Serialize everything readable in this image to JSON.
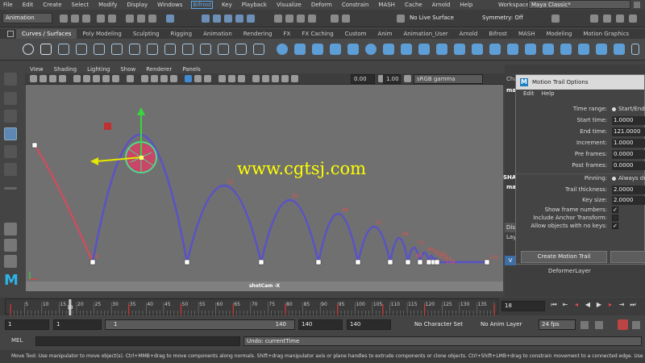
{
  "menubar": {
    "items": [
      "File",
      "Edit",
      "Create",
      "Select",
      "Modify",
      "Display",
      "Windows",
      "Bifrost",
      "Key",
      "Playback",
      "Visualize",
      "Deform",
      "Constrain",
      "MASH",
      "Cache",
      "Arnold",
      "Help"
    ],
    "highlighted": "Bifrost",
    "workspace_label": "Workspace :",
    "workspace_value": "Maya Classic*"
  },
  "status": {
    "mode": "Animation",
    "live_surface": "No Live Surface",
    "symmetry": "Symmetry: Off"
  },
  "shelf": {
    "tabs": [
      "Curves / Surfaces",
      "Poly Modeling",
      "Sculpting",
      "Rigging",
      "Animation",
      "Rendering",
      "FX",
      "FX Caching",
      "Custom",
      "Anim",
      "Animation_User",
      "Arnold",
      "Bifrost",
      "MASH",
      "Modeling",
      "Motion Graphics"
    ],
    "active_tab": "Curves / Surfaces"
  },
  "panel": {
    "menus": [
      "View",
      "Shading",
      "Lighting",
      "Show",
      "Renderer",
      "Panels"
    ],
    "exposure": "0.00",
    "gamma": "1.00",
    "color_space": "sRGB gamma",
    "camera": "shotCam -X"
  },
  "watermark": "www.cgtsj.com",
  "chart_data": {
    "type": "line",
    "title": "",
    "series": [
      {
        "name": "",
        "color": "#cc4e5e",
        "x": [
          1,
          18
        ],
        "y": [
          0,
          0
        ]
      },
      {
        "name": "",
        "color": "#5a52c6",
        "x": [
          18,
          35,
          50,
          65,
          80,
          95,
          108,
          120,
          140
        ],
        "y": [
          0,
          0,
          0,
          0,
          0,
          0,
          0,
          0,
          0
        ]
      }
    ],
    "frame_labels": [
      "8",
      "18",
      "22",
      "36",
      "48",
      "57",
      "66",
      "73",
      "83",
      "88",
      "92",
      "106",
      "112",
      "116",
      "118",
      "121"
    ]
  },
  "right_panel": {
    "channel_box_label": "Char",
    "shape_label": "SHAPE",
    "node_label": "main",
    "display_tab": "Disp",
    "layer_tab": "Laye",
    "deformer_layer": "DeformerLayer",
    "layer_v": "V"
  },
  "motion_trail": {
    "title": "Motion Trail Options",
    "menus": [
      "Edit",
      "Help"
    ],
    "time_range_label": "Time range:",
    "time_range_value": "Start/End",
    "start_time_label": "Start time:",
    "start_time": "1.0000",
    "end_time_label": "End time:",
    "end_time": "121.0000",
    "increment_label": "Increment:",
    "increment": "1.0000",
    "pre_frames_label": "Pre frames:",
    "pre_frames": "0.0000",
    "post_frames_label": "Post frames:",
    "post_frames": "0.0000",
    "pinning_label": "Pinning:",
    "pinning_value": "Always dra",
    "thickness_label": "Trail thickness:",
    "thickness": "2.0000",
    "key_size_label": "Key size:",
    "key_size": "2.0000",
    "show_frames_label": "Show frame numbers:",
    "show_frames": true,
    "anchor_label": "Include Anchor Transform:",
    "anchor": false,
    "allow_nokeys_label": "Allow objects with no keys:",
    "allow_nokeys": true,
    "create_button": "Create Motion Trail"
  },
  "timeline": {
    "ticks": [
      "5",
      "10",
      "15",
      "20",
      "25",
      "30",
      "35",
      "40",
      "45",
      "50",
      "55",
      "60",
      "65",
      "70",
      "75",
      "80",
      "85",
      "90",
      "95",
      "100",
      "105",
      "110",
      "115",
      "120",
      "125",
      "130",
      "135"
    ],
    "current_frame_label": "18",
    "current_frame": "18"
  },
  "range": {
    "start": "1",
    "anim_start": "1",
    "slider_start": "1",
    "slider_end": "140",
    "anim_end_a": "140",
    "anim_end_b": "140",
    "character_set": "No Character Set",
    "anim_layer": "No Anim Layer",
    "fps": "24 fps"
  },
  "command": {
    "lang": "MEL",
    "result": "Undo: currentTime"
  },
  "help_line": "Move Tool: Use manipulator to move object(s). Ctrl+MMB+drag to move components along normals. Shift+drag manipulator axis or plane handles to extrude components or clone objects. Ctrl+Shift+LMB+drag to constrain movement to a connected edge. Use D or INSERT to change"
}
